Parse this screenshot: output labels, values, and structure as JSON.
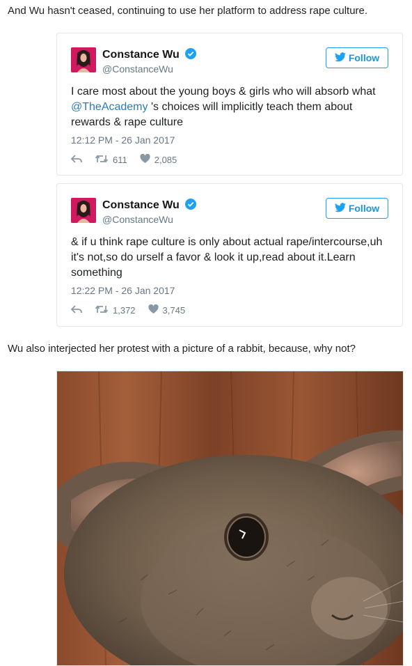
{
  "article": {
    "intro": "And Wu hasn't ceased, continuing to use her platform to address rape culture.",
    "mid": "Wu also interjected her protest with a picture of a rabbit, because, why not?"
  },
  "tweets": [
    {
      "name": "Constance Wu",
      "handle": "@ConstanceWu",
      "follow_label": "Follow",
      "text_before": "I care most about the young boys & girls who will absorb what ",
      "mention": "@TheAcademy",
      "text_after": " 's choices will implicitly teach them about rewards & rape culture",
      "timestamp": "12:12 PM - 26 Jan 2017",
      "retweets": "611",
      "likes": "2,085"
    },
    {
      "name": "Constance Wu",
      "handle": "@ConstanceWu",
      "follow_label": "Follow",
      "text": "& if u think rape culture is only about actual rape/intercourse,uh it's not,so do urself a favor & look it up,read about it.Learn something",
      "timestamp": "12:22 PM - 26 Jan 2017",
      "retweets": "1,372",
      "likes": "3,745"
    }
  ],
  "icons": [
    "verified-icon",
    "twitter-bird-icon",
    "reply-icon",
    "retweet-icon",
    "heart-icon"
  ],
  "colors": {
    "twitter_blue": "#1da1f2",
    "link": "#2b7bb9",
    "muted": "#657786"
  }
}
